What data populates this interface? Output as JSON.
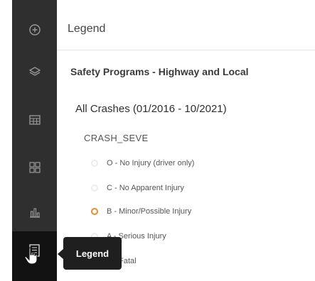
{
  "toolbar": {
    "items": [
      {
        "icon": "add-circle-icon"
      },
      {
        "icon": "layers-icon"
      },
      {
        "icon": "table-icon"
      },
      {
        "icon": "grid-icon"
      },
      {
        "icon": "bar-chart-icon"
      },
      {
        "icon": "legend-icon",
        "active": true
      }
    ],
    "tooltip": "Legend"
  },
  "legend": {
    "title": "Legend",
    "layer_name": "Safety Programs - Highway and Local",
    "sublayer_name": "All Crashes (01/2016 - 10/2021)",
    "field_name": "CRASH_SEVE",
    "items": [
      {
        "label": "O - No Injury (driver only)",
        "color": "#ececec"
      },
      {
        "label": "C - No Apparent Injury",
        "color": "#ececec"
      },
      {
        "label": "B - Minor/Possible Injury",
        "color": "#f08a24"
      },
      {
        "label": "A - Serious Injury",
        "color": "#ececec"
      },
      {
        "label": "K - Fatal",
        "color": "#ececec"
      }
    ]
  },
  "colors": {
    "toolbar_bg": "#2f2f2f",
    "toolbar_active": "#121212",
    "accent": "#f08a24"
  }
}
